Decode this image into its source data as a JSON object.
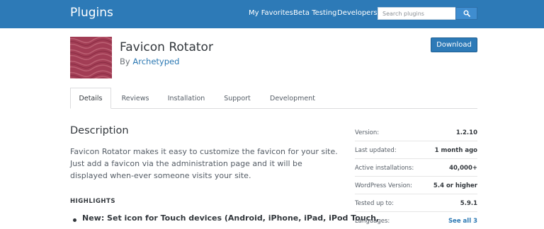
{
  "header": {
    "brand": "Plugins",
    "nav": [
      "My Favorites",
      "Beta Testing",
      "Developers"
    ],
    "search_placeholder": "Search plugins",
    "search_icon": "magnifier-icon",
    "background_color": "#2d7ab7"
  },
  "plugin": {
    "title": "Favicon Rotator",
    "by_prefix": "By",
    "author": "Archetyped",
    "download_label": "Download",
    "icon": "wavy-pattern-icon",
    "icon_color": "#a23d55"
  },
  "tabs": [
    "Details",
    "Reviews",
    "Installation",
    "Support",
    "Development"
  ],
  "active_tab": "Details",
  "description": {
    "heading": "Description",
    "text": "Favicon Rotator makes it easy to customize the favicon for your site. Just add a favicon via the administration page and it will be displayed when-ever someone visits your site.",
    "highlights_heading": "HIGHLIGHTS",
    "highlights": [
      "New: Set icon for Touch devices (Android, iPhone, iPad, iPod Touch,"
    ]
  },
  "meta": [
    {
      "label": "Version:",
      "value": "1.2.10"
    },
    {
      "label": "Last updated:",
      "value": "1 month ago"
    },
    {
      "label": "Active installations:",
      "value": "40,000+"
    },
    {
      "label": "WordPress Version:",
      "value": "5.4 or higher"
    },
    {
      "label": "Tested up to:",
      "value": "5.9.1"
    },
    {
      "label": "Languages:",
      "value": "See all 3"
    }
  ]
}
